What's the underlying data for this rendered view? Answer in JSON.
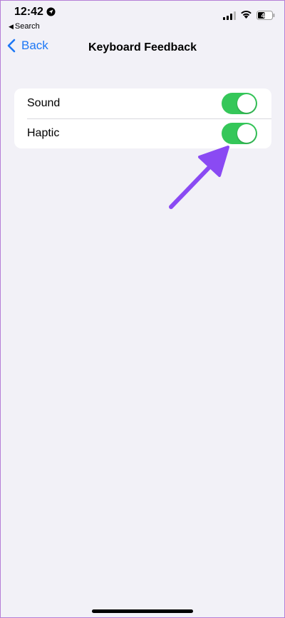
{
  "status_bar": {
    "time": "12:42",
    "back_label": "Search",
    "battery": "43"
  },
  "nav": {
    "back_label": "Back",
    "title": "Keyboard Feedback"
  },
  "settings": {
    "rows": [
      {
        "label": "Sound",
        "enabled": true
      },
      {
        "label": "Haptic",
        "enabled": true
      }
    ]
  },
  "colors": {
    "background": "#f2f1f7",
    "accent": "#1e78f5",
    "toggle_on": "#35c759",
    "annotation_arrow": "#8a4af3"
  },
  "icons": {
    "location": "location-arrow-icon",
    "signal": "cellular-signal-icon",
    "wifi": "wifi-icon",
    "battery": "battery-icon",
    "back": "chevron-left-icon"
  }
}
